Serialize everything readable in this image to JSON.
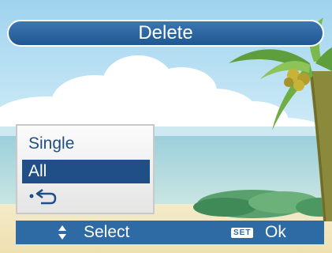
{
  "title": "Delete",
  "menu": {
    "items": [
      {
        "label": "Single",
        "selected": false
      },
      {
        "label": "All",
        "selected": true
      },
      {
        "label": "",
        "icon": "return-back-icon",
        "selected": false
      }
    ]
  },
  "status_bar": {
    "select_label": "Select",
    "set_badge": "SET",
    "ok_label": "Ok",
    "select_icon": "up-down-arrow-icon"
  },
  "colors": {
    "title_bar": "#2e6aa3",
    "selected_item": "#1f4f86",
    "status_bar": "#2e6aa3"
  }
}
